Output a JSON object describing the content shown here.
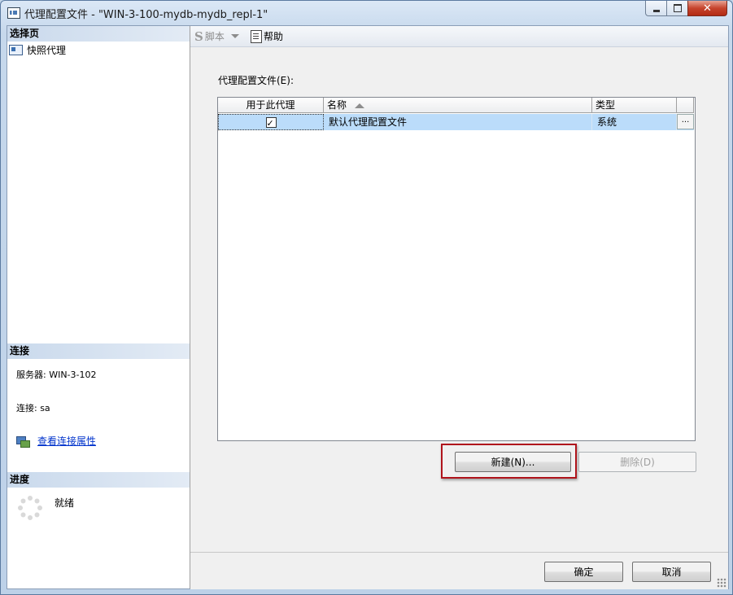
{
  "window": {
    "title": "代理配置文件 - \"WIN-3-100-mydb-mydb_repl-1\"",
    "app_icon": "agent-window-icon"
  },
  "left_pane": {
    "select_page_header": "选择页",
    "pages": [
      {
        "label": "快照代理",
        "icon": "agent-icon"
      }
    ],
    "connection_header": "连接",
    "server_line": "服务器: WIN-3-102",
    "connection_line": "连接: sa",
    "view_connection_link": "查看连接属性",
    "progress_header": "进度",
    "progress_status": "就绪"
  },
  "toolbar": {
    "script_label": "脚本",
    "help_label": "帮助"
  },
  "main": {
    "profiles_label": "代理配置文件(E):",
    "columns": [
      "用于此代理",
      "名称",
      "类型",
      ""
    ],
    "rows": [
      {
        "use_for_agent": true,
        "name": "默认代理配置文件",
        "type": "系统",
        "details_button": "..."
      }
    ],
    "new_button": "新建(N)...",
    "delete_button": "删除(D)"
  },
  "footer": {
    "ok_button": "确定",
    "cancel_button": "取消"
  },
  "colors": {
    "selected_row": "#bbdcfa",
    "highlight_frame": "#b0141c",
    "link": "#0033cc"
  }
}
